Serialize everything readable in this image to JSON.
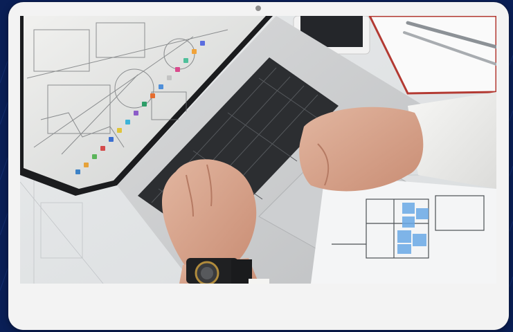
{
  "photo": {
    "subject": "laptop-on-architectural-blueprints"
  },
  "colors": {
    "background": "#0a1f56",
    "device_frame": "#f3f3f3",
    "camera_dot": "#8d8d8d"
  }
}
